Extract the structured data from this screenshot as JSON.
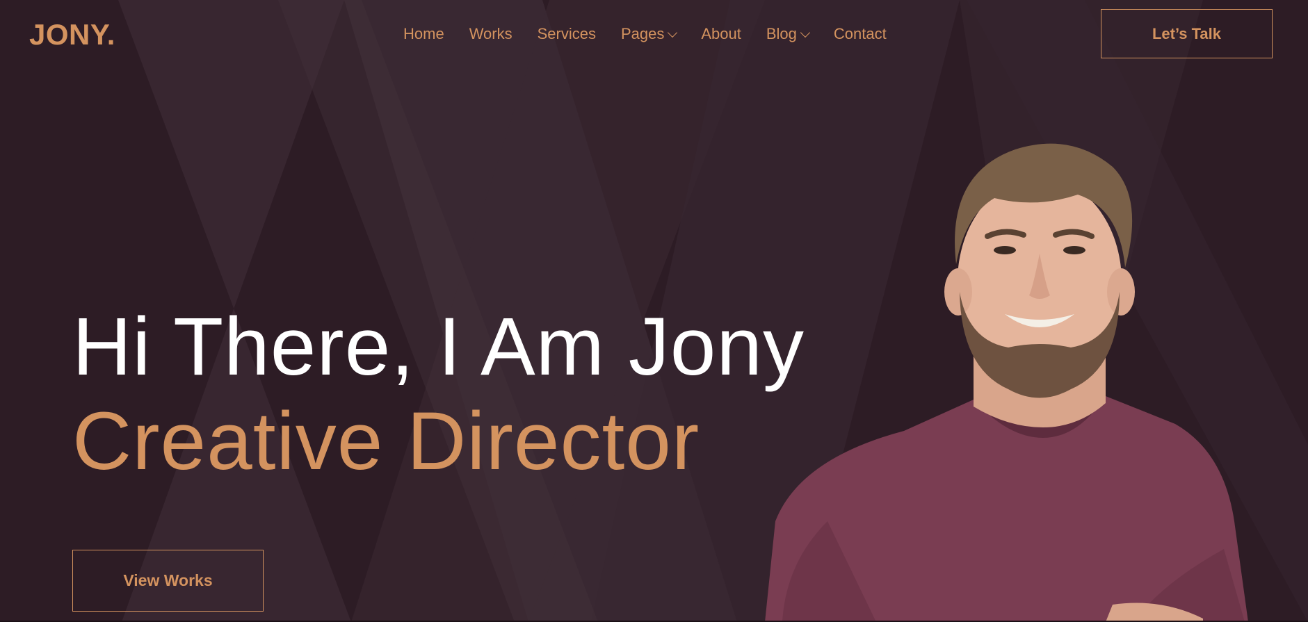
{
  "brand": {
    "logo": "JONY."
  },
  "nav": {
    "items": [
      {
        "label": "Home",
        "dropdown": false
      },
      {
        "label": "Works",
        "dropdown": false
      },
      {
        "label": "Services",
        "dropdown": false
      },
      {
        "label": "Pages",
        "dropdown": true
      },
      {
        "label": "About",
        "dropdown": false
      },
      {
        "label": "Blog",
        "dropdown": true
      },
      {
        "label": "Contact",
        "dropdown": false
      }
    ],
    "cta_label": "Let’s Talk"
  },
  "hero": {
    "title": "Hi There, I Am Jony",
    "subtitle": "Creative Director",
    "button_label": "View Works"
  },
  "colors": {
    "background": "#2d1c25",
    "accent": "#d4935f",
    "heading": "#ffffff",
    "shirt": "#7a3d52"
  },
  "icons": {
    "dropdown": "chevron-down-icon"
  }
}
